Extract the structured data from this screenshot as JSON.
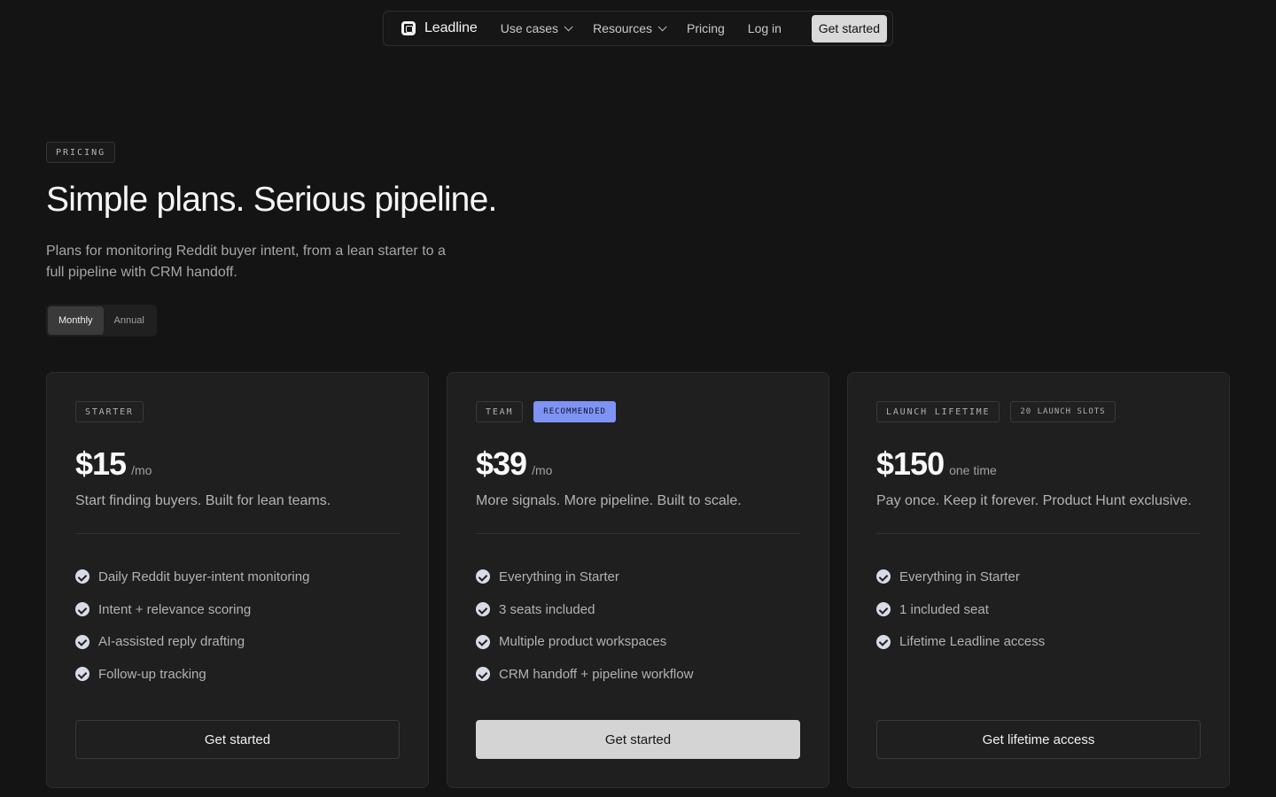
{
  "nav": {
    "brand": "Leadline",
    "items": [
      {
        "label": "Use cases",
        "dropdown": true
      },
      {
        "label": "Resources",
        "dropdown": true
      },
      {
        "label": "Pricing",
        "dropdown": false
      }
    ],
    "login": "Log in",
    "cta": "Get started"
  },
  "hero": {
    "badge": "PRICING",
    "title": "Simple plans. Serious pipeline.",
    "subtitle": "Plans for monitoring Reddit buyer intent, from a lean starter to a full pipeline with CRM handoff.",
    "billing_options": [
      "Monthly",
      "Annual"
    ],
    "billing_selected": "Monthly"
  },
  "plans": [
    {
      "tag": "STARTER",
      "extra_tag": "",
      "price": "$15",
      "period": "/mo",
      "description": "Start finding buyers. Built for lean teams.",
      "features": [
        "Daily Reddit buyer-intent monitoring",
        "Intent + relevance scoring",
        "AI-assisted reply drafting",
        "Follow-up tracking"
      ],
      "cta": "Get started",
      "primary": false
    },
    {
      "tag": "TEAM",
      "extra_tag": "RECOMMENDED",
      "price": "$39",
      "period": "/mo",
      "description": "More signals. More pipeline. Built to scale.",
      "features": [
        "Everything in Starter",
        "3 seats included",
        "Multiple product workspaces",
        "CRM handoff + pipeline workflow"
      ],
      "cta": "Get started",
      "primary": true
    },
    {
      "tag": "LAUNCH LIFETIME",
      "extra_tag": "20 LAUNCH SLOTS",
      "price": "$150",
      "period": "one time",
      "description": "Pay once. Keep it forever. Product Hunt exclusive.",
      "features": [
        "Everything in Starter",
        "1 included seat",
        "Lifetime Leadline access"
      ],
      "cta": "Get lifetime access",
      "primary": false
    }
  ],
  "colors": {
    "background": "#141414",
    "card": "#1f1f1f",
    "accent_recommended": "#7f93f5",
    "primary_button": "#d4d4d4"
  }
}
